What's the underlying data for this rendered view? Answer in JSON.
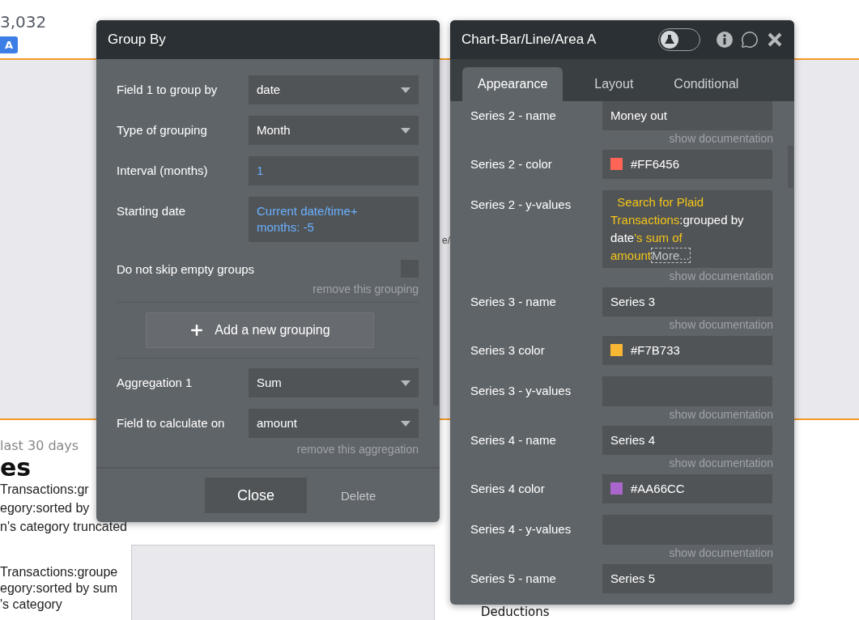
{
  "background": {
    "amount": "3,032",
    "badge": "A",
    "url_fragment": "e/",
    "period": "last 30 days",
    "heading": "es",
    "lines_top": [
      "Transactions:gr",
      "egory:sorted by",
      "n's category truncated"
    ],
    "lines_bottom": [
      "Transactions:groupe",
      "egory:sorted by sum",
      "'s category"
    ],
    "footer_heading": "Deductions"
  },
  "group_by": {
    "title": "Group By",
    "fields": [
      {
        "label": "Field 1 to group by",
        "kind": "dropdown",
        "value": "date"
      },
      {
        "label": "Type of grouping",
        "kind": "dropdown",
        "value": "Month"
      },
      {
        "label": "Interval (months)",
        "kind": "dynamic",
        "value": "1"
      },
      {
        "label": "Starting date",
        "kind": "dynamic",
        "value": "Current date/time+ months: -5"
      }
    ],
    "skip_option": {
      "label": "Do not skip empty groups",
      "checked": false
    },
    "remove_grouping": "remove this grouping",
    "add_button": "Add a new grouping",
    "aggregation": [
      {
        "label": "Aggregation 1",
        "kind": "dropdown",
        "value": "Sum"
      },
      {
        "label": "Field to calculate on",
        "kind": "dropdown",
        "value": "amount"
      }
    ],
    "remove_aggregation": "remove this aggregation",
    "close_button": "Close",
    "delete_button": "Delete"
  },
  "chart_panel": {
    "title": "Chart-Bar/Line/Area A",
    "toggle": {
      "on": false
    },
    "tabs": [
      {
        "label": "Appearance",
        "selected": true
      },
      {
        "label": "Layout",
        "selected": false
      },
      {
        "label": "Conditional",
        "selected": false
      }
    ],
    "rows": [
      {
        "label": "Series 2 - name",
        "kind": "text",
        "value": "Money out",
        "doc": "show documentation"
      },
      {
        "label": "Series 2 - color",
        "kind": "color",
        "value": "#FF6456",
        "color": "#ff6456"
      },
      {
        "label": "Series 2 - y-values",
        "kind": "expression",
        "segments": [
          {
            "text": "Search for Plaid Transactions",
            "kind": "dynamic"
          },
          {
            "text": ":grouped by date",
            "kind": "plain"
          },
          {
            "text": "'s sum of amount",
            "kind": "dynamic"
          },
          {
            "text": "More...",
            "kind": "more"
          }
        ],
        "doc": "show documentation"
      },
      {
        "label": "Series 3 - name",
        "kind": "text",
        "value": "Series 3",
        "doc": "show documentation"
      },
      {
        "label": "Series 3 color",
        "kind": "color",
        "value": "#F7B733",
        "color": "#f7b733"
      },
      {
        "label": "Series 3 - y-values",
        "kind": "expression",
        "segments": [],
        "doc": "show documentation"
      },
      {
        "label": "Series 4 - name",
        "kind": "text",
        "value": "Series 4",
        "doc": "show documentation"
      },
      {
        "label": "Series 4 color",
        "kind": "color",
        "value": "#AA66CC",
        "color": "#aa66cc"
      },
      {
        "label": "Series 4 - y-values",
        "kind": "expression",
        "segments": [],
        "doc": "show documentation"
      },
      {
        "label": "Series 5 - name",
        "kind": "text",
        "value": "Series 5"
      }
    ]
  }
}
